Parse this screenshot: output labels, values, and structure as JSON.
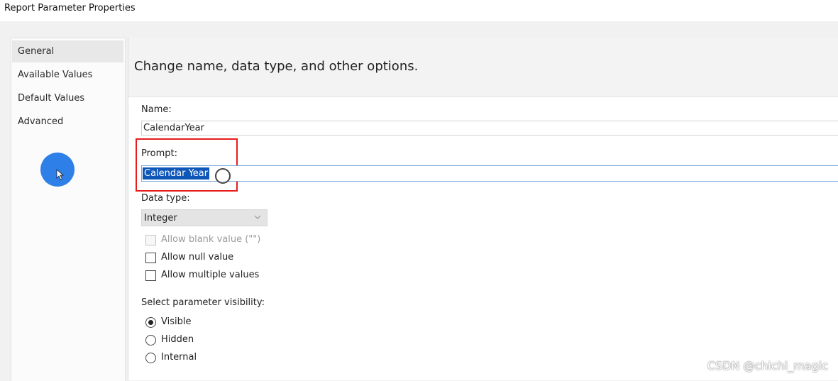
{
  "window": {
    "title": "Report Parameter Properties"
  },
  "sidebar": {
    "items": [
      {
        "label": "General"
      },
      {
        "label": "Available Values"
      },
      {
        "label": "Default Values"
      },
      {
        "label": "Advanced"
      }
    ]
  },
  "main": {
    "header": "Change name, data type, and other options.",
    "name": {
      "label": "Name:",
      "value": "CalendarYear"
    },
    "prompt": {
      "label": "Prompt:",
      "value": "Calendar Year"
    },
    "data_type": {
      "label": "Data type:",
      "value": "Integer"
    },
    "checks": {
      "blank": "Allow blank value (\"\")",
      "null": "Allow null value",
      "multiple": "Allow multiple values"
    },
    "visibility": {
      "label": "Select parameter visibility:",
      "options": [
        {
          "label": "Visible"
        },
        {
          "label": "Hidden"
        },
        {
          "label": "Internal"
        }
      ]
    }
  },
  "watermark": "CSDN @chichi_magic",
  "colors": {
    "highlight_box": "#e81c1c",
    "selection": "#0e57b8",
    "cursor": "#2f7fe8"
  }
}
